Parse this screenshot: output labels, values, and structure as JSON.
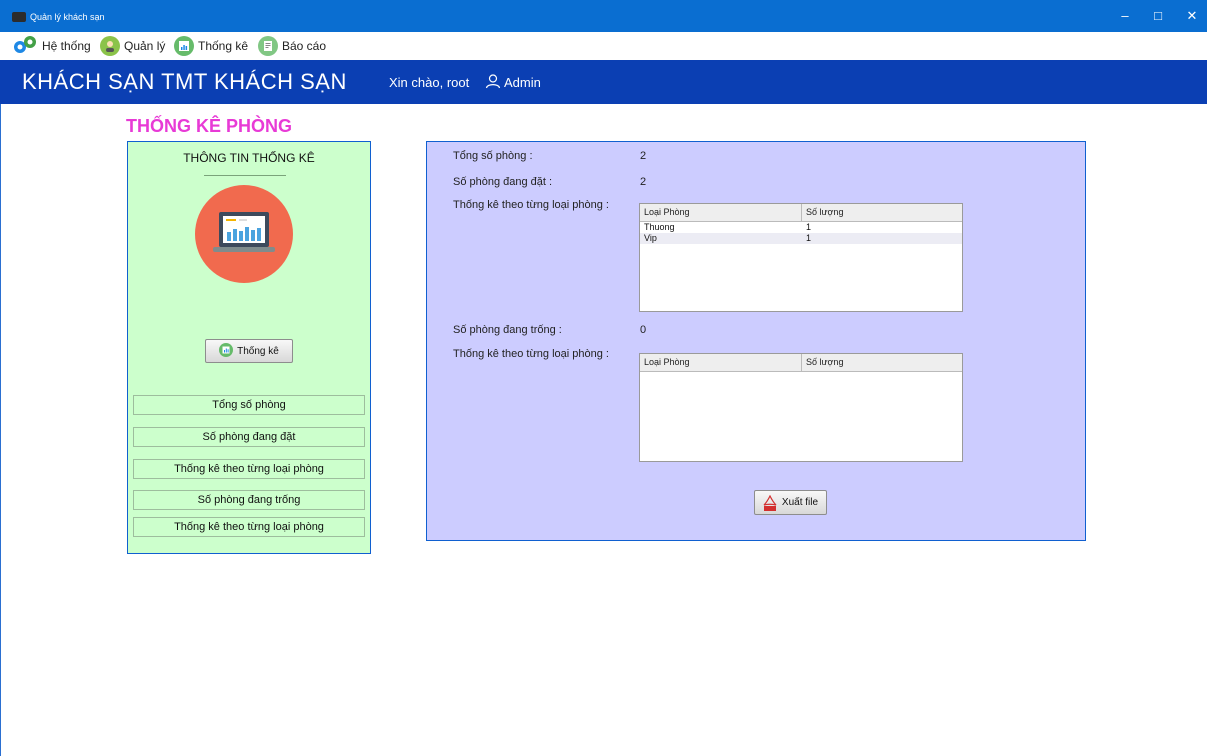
{
  "window": {
    "title": "Quản lý khách sạn",
    "controls": {
      "minimize": "–",
      "maximize": "□",
      "close": "✕"
    }
  },
  "menubar": {
    "items": [
      {
        "label": "Hệ thống",
        "icon": "system-settings-icon"
      },
      {
        "label": "Quản lý",
        "icon": "manager-person-icon"
      },
      {
        "label": "Thống kê",
        "icon": "statistics-chart-icon"
      },
      {
        "label": "Báo cáo",
        "icon": "report-document-icon"
      }
    ]
  },
  "banner": {
    "hotel_name": "KHÁCH SẠN TMT KHÁCH SẠN",
    "greeting": "Xin chào, root",
    "role": "Admin"
  },
  "page": {
    "title": "THỐNG KÊ PHÒNG"
  },
  "left_panel": {
    "heading": "THÔNG TIN THỐNG KÊ",
    "stat_button": "Thống kê",
    "nav_items": [
      "Tổng số phòng",
      "Số phòng đang đặt",
      "Thống kê theo từng loại phòng",
      "Số phòng đang trống",
      "Thống kê theo từng loại phòng"
    ]
  },
  "stats": {
    "total_label": "Tổng số phòng :",
    "total_value": "2",
    "booked_label": "Số phòng đang đặt  :",
    "booked_value": "2",
    "by_type_label_1": "Thống kê theo từng loại phòng :",
    "vacant_label": "Số phòng đang trống :",
    "vacant_value": "0",
    "by_type_label_2": "Thống kê theo từng loại phòng :"
  },
  "booked_table": {
    "columns": [
      "Loại Phòng",
      "Số lượng"
    ],
    "rows": [
      [
        "Thuong",
        "1"
      ],
      [
        "Vip",
        "1"
      ]
    ]
  },
  "vacant_table": {
    "columns": [
      "Loại Phòng",
      "Số lượng"
    ],
    "rows": []
  },
  "export_button": "Xuất file",
  "colors": {
    "titlebar": "#0a6ed1",
    "banner": "#0b3fb3",
    "page_title": "#e83ad6",
    "left_panel_bg": "#ccffcc",
    "right_panel_bg": "#ccccff"
  }
}
